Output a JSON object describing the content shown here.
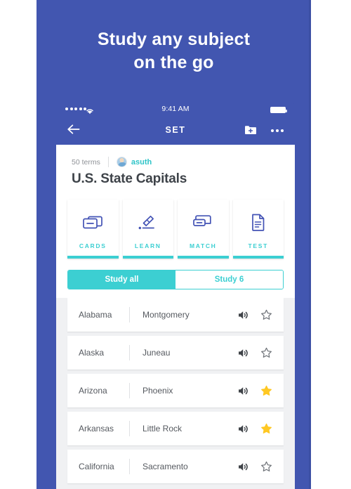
{
  "promo": {
    "headline_line1": "Study any subject",
    "headline_line2": "on the go",
    "background_color": "#4256b0"
  },
  "status_bar": {
    "time": "9:41 AM",
    "signal_icon": "signal-dots-icon",
    "wifi_icon": "wifi-icon",
    "battery_icon": "battery-full-icon"
  },
  "nav_bar": {
    "back_icon": "back-arrow-icon",
    "title": "SET",
    "add_to_folder_icon": "folder-plus-icon",
    "more_icon": "overflow-menu-icon"
  },
  "set_header": {
    "term_count": "50 terms",
    "author": "asuth",
    "avatar_icon": "user-avatar",
    "title": "U.S. State Capitals"
  },
  "study_modes": [
    {
      "label": "CARDS",
      "icon": "flashcards-icon"
    },
    {
      "label": "LEARN",
      "icon": "pencil-writing-icon"
    },
    {
      "label": "MATCH",
      "icon": "match-card-icon"
    },
    {
      "label": "TEST",
      "icon": "document-icon"
    }
  ],
  "segment_control": {
    "options": [
      {
        "label": "Study all",
        "active": true
      },
      {
        "label": "Study 6",
        "active": false
      }
    ]
  },
  "terms": [
    {
      "term": "Alabama",
      "definition": "Montgomery",
      "audio_icon": "speaker-icon",
      "star_icon": "star-outline-icon",
      "starred": false
    },
    {
      "term": "Alaska",
      "definition": "Juneau",
      "audio_icon": "speaker-icon",
      "star_icon": "star-outline-icon",
      "starred": false
    },
    {
      "term": "Arizona",
      "definition": "Phoenix",
      "audio_icon": "speaker-icon",
      "star_icon": "star-filled-icon",
      "starred": true
    },
    {
      "term": "Arkansas",
      "definition": "Little Rock",
      "audio_icon": "speaker-icon",
      "star_icon": "star-filled-icon",
      "starred": true
    },
    {
      "term": "California",
      "definition": "Sacramento",
      "audio_icon": "speaker-icon",
      "star_icon": "star-outline-icon",
      "starred": false
    }
  ],
  "colors": {
    "brand_blue": "#4256b0",
    "icon_blue": "#4353b5",
    "teal": "#3ccfd2",
    "star_gold": "#ffc823",
    "text_gray": "#55595f"
  }
}
